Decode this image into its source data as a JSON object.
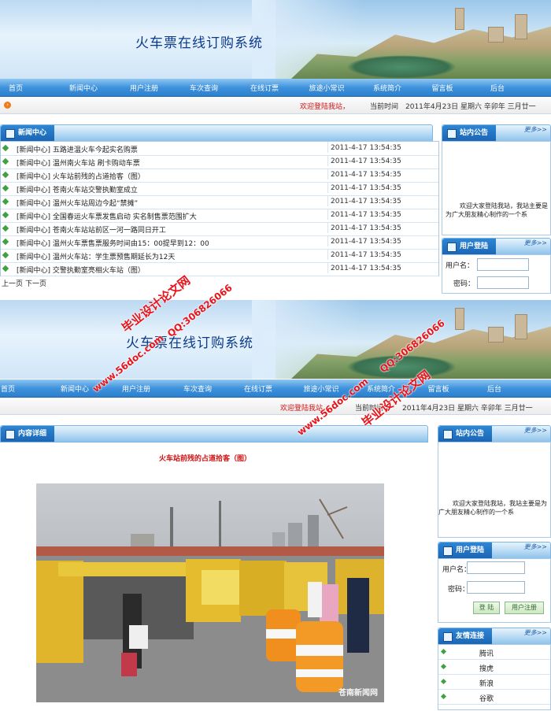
{
  "site": {
    "title": "火车票在线订购系统"
  },
  "nav": [
    "首页",
    "新闻中心",
    "用户注册",
    "车次查询",
    "在线订票",
    "旅途小常识",
    "系统简介",
    "留言板",
    "后台"
  ],
  "status": {
    "welcome": "欢迎登陆我站，",
    "time_label": "当前时间",
    "date": "2011年4月23日 星期六 辛卯年 三月廿一"
  },
  "news": {
    "header": "新闻中心",
    "items": [
      {
        "title": "[新闻中心] 五路进温火车今起实名购票",
        "date": "2011-4-17 13:54:35"
      },
      {
        "title": "[新闻中心] 温州南火车站 刷卡购动车票",
        "date": "2011-4-17 13:54:35"
      },
      {
        "title": "[新闻中心] 火车站前残的占道拾客（图）",
        "date": "2011-4-17 13:54:35"
      },
      {
        "title": "[新闻中心] 苍南火车站交警执勤室成立",
        "date": "2011-4-17 13:54:35"
      },
      {
        "title": "[新闻中心] 温州火车站周边今起“禁摊”",
        "date": "2011-4-17 13:54:35"
      },
      {
        "title": "[新闻中心] 全国春运火车票发售启动 实名制售票范围扩大",
        "date": "2011-4-17 13:54:35"
      },
      {
        "title": "[新闻中心] 苍南火车站站前区一河一路同日开工",
        "date": "2011-4-17 13:54:35"
      },
      {
        "title": "[新闻中心] 温州火车票售票服务时间由15：00提早到12：00",
        "date": "2011-4-17 13:54:35"
      },
      {
        "title": "[新闻中心] 温州火车站：学生票预售期延长为12天",
        "date": "2011-4-17 13:54:35"
      },
      {
        "title": "[新闻中心] 交警执勤室亮相火车站（图）",
        "date": "2011-4-17 13:54:35"
      }
    ],
    "pager_prev": "上一页",
    "pager_next": "下一页"
  },
  "sidebar": {
    "notice_header": "站内公告",
    "more": "更多>>",
    "notice_text_1": "欢迎大家登陆我站，我站主要是为广大朋友精心制作的一个系",
    "notice_text_2": "欢迎大家登陆我站，我站主要是为广大朋友精心制作的一个系",
    "login_header": "用户登陆",
    "username_label": "用户名：",
    "password_label": "密码：",
    "login_button": "登 陆",
    "register_button": "用户注册",
    "links_header": "友情连接",
    "links": [
      "腾讯",
      "搜虎",
      "新浪",
      "谷歌"
    ]
  },
  "detail": {
    "header": "内容详细",
    "article_title": "火车站前残的占道拾客（图）",
    "photo_caption": "苍南新闻网"
  },
  "watermark": {
    "cn": "毕业设计论文网",
    "url": "www.56doc.com",
    "qq": "QQ:306826066"
  },
  "colors": {
    "nav": "#3f93dd",
    "welcome": "#d01212",
    "title": "#0b3a8c"
  }
}
